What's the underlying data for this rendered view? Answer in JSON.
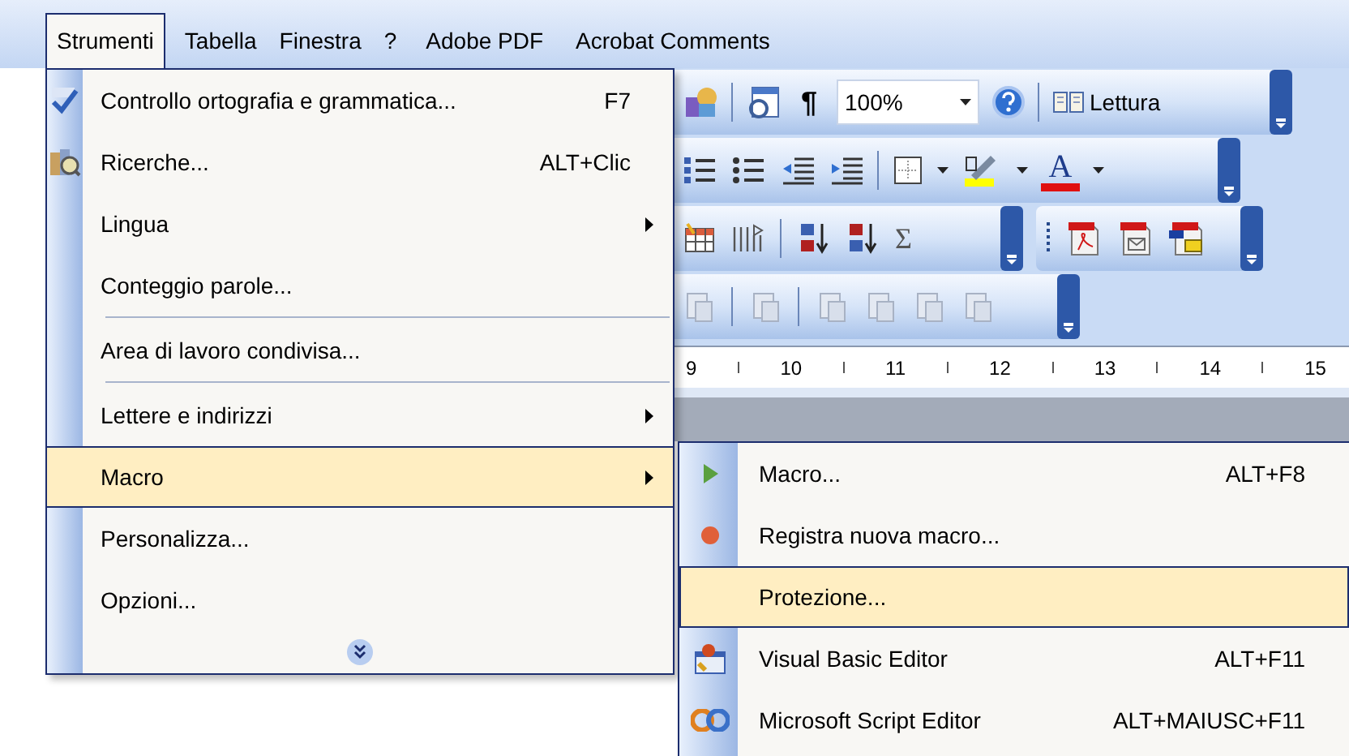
{
  "menubar": [
    {
      "label": "Strumenti",
      "selected": true
    },
    {
      "label": "Tabella",
      "selected": false
    },
    {
      "label": "Finestra",
      "selected": false
    },
    {
      "label": "?",
      "selected": false
    },
    {
      "label": "Adobe PDF",
      "selected": false
    },
    {
      "label": "Acrobat Comments",
      "selected": false
    }
  ],
  "toolbars": {
    "paragraph_mark": "¶",
    "zoom": {
      "value": "100%"
    },
    "reading": {
      "label": "Lettura"
    },
    "font_color": "A",
    "sum": "Σ"
  },
  "ruler": {
    "labels": [
      "9",
      "10",
      "11",
      "12",
      "13",
      "14",
      "15"
    ]
  },
  "menu": {
    "items": [
      {
        "kind": "item",
        "label": "Controllo ortografia e grammatica...",
        "shortcut": "F7",
        "submenu": false,
        "selected": false
      },
      {
        "kind": "item",
        "label": "Ricerche...",
        "shortcut": "ALT+Clic",
        "submenu": false,
        "selected": false
      },
      {
        "kind": "item",
        "label": "Lingua",
        "submenu": true,
        "selected": false
      },
      {
        "kind": "item",
        "label": "Conteggio parole...",
        "submenu": false,
        "selected": false
      },
      {
        "kind": "separator"
      },
      {
        "kind": "item",
        "label": "Area di lavoro condivisa...",
        "submenu": false,
        "selected": false
      },
      {
        "kind": "separator"
      },
      {
        "kind": "item",
        "label": "Lettere e indirizzi",
        "submenu": true,
        "selected": false
      },
      {
        "kind": "item",
        "label": "Macro",
        "submenu": true,
        "selected": true
      },
      {
        "kind": "item",
        "label": "Personalizza...",
        "submenu": false,
        "selected": false
      },
      {
        "kind": "item",
        "label": "Opzioni...",
        "submenu": false,
        "selected": false
      },
      {
        "kind": "more"
      }
    ]
  },
  "submenu": {
    "items": [
      {
        "label": "Macro...",
        "shortcut": "ALT+F8",
        "selected": false
      },
      {
        "label": "Registra nuova macro...",
        "selected": false
      },
      {
        "label": "Protezione...",
        "selected": true
      },
      {
        "label": "Visual Basic Editor",
        "shortcut": "ALT+F11",
        "selected": false
      },
      {
        "label": "Microsoft Script Editor",
        "shortcut": "ALT+MAIUSC+F11",
        "selected": false
      }
    ]
  }
}
